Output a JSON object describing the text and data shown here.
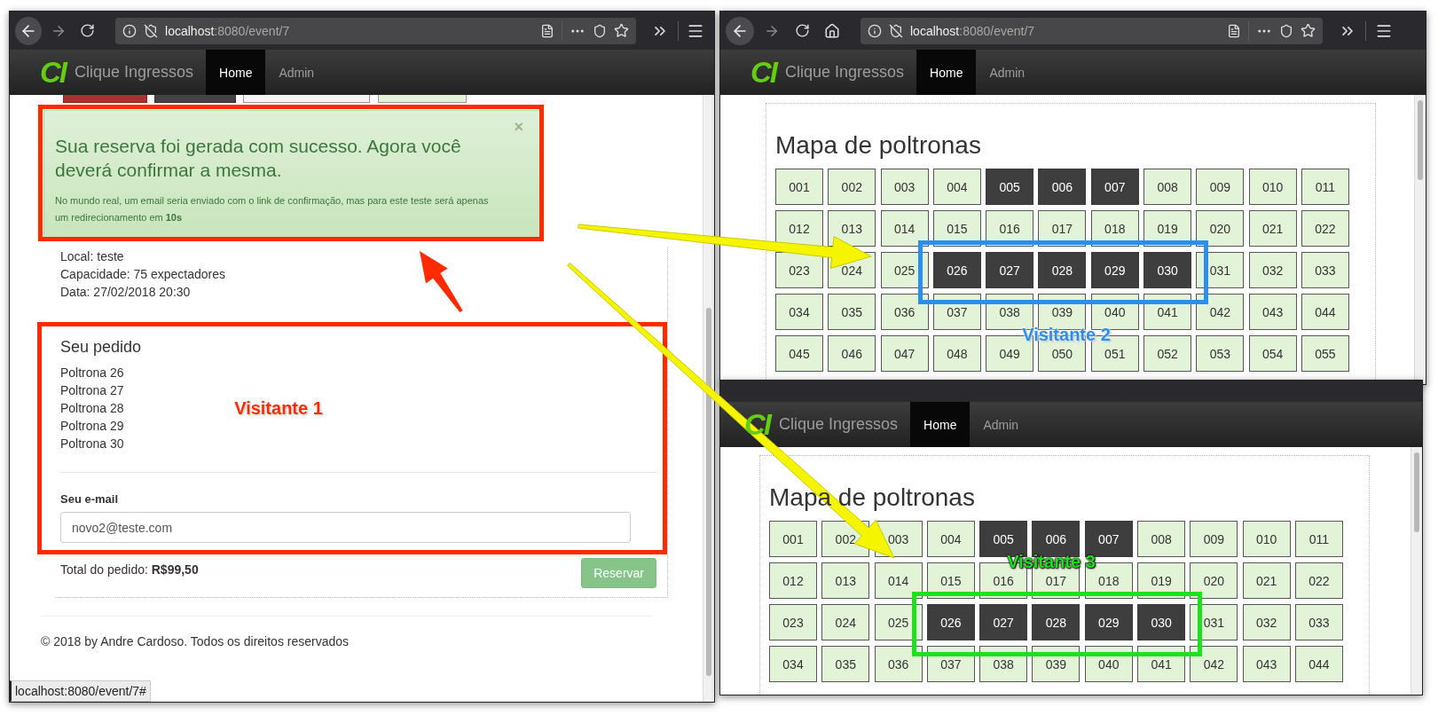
{
  "windows": [
    {
      "kind": "reservation",
      "toolbar": {
        "url_host": "localhost",
        "url_path": ":8080/event/7",
        "home_button": false
      },
      "navbar": {
        "logo": "CI",
        "brand": "Clique Ingressos",
        "tabs": [
          {
            "label": "Home",
            "selected": true
          },
          {
            "label": "Admin",
            "selected": false
          }
        ]
      },
      "page": {
        "alert": {
          "close": "×",
          "heading": "Sua reserva foi gerada com sucesso. Agora você deverá confirmar a mesma.",
          "body": "No mundo real, um email seria enviado com o link de confirmação, mas para este teste será apenas um redirecionamento em **10s**"
        },
        "event_info": [
          "Local: teste",
          "Capacidade: 75 expectadores",
          "Data: 27/02/2018 20:30"
        ],
        "order_heading": "Seu pedido",
        "order_items": [
          "Poltrona 26",
          "Poltrona 27",
          "Poltrona 28",
          "Poltrona 29",
          "Poltrona 30"
        ],
        "email_label": "Seu e-mail",
        "email_value": "novo2@teste.com",
        "total": "Total do pedido: **R$99,50**",
        "reserve_button": "Reservar",
        "footer": "© 2018 by Andre Cardoso. Todos os direitos reservados",
        "status_bar": "localhost:8080/event/7#"
      }
    },
    {
      "kind": "seat_map",
      "toolbar": {
        "url_host": "localhost",
        "url_path": ":8080/event/7",
        "home_button": true
      },
      "navbar": {
        "logo": "CI",
        "brand": "Clique Ingressos",
        "tabs": [
          {
            "label": "Home",
            "selected": true
          },
          {
            "label": "Admin",
            "selected": false
          }
        ]
      },
      "page": {
        "heading": "Mapa de poltronas",
        "seat_rows": [
          [
            {
              "label": "001",
              "taken": false
            },
            {
              "label": "002",
              "taken": false
            },
            {
              "label": "003",
              "taken": false
            },
            {
              "label": "004",
              "taken": false
            },
            {
              "label": "005",
              "taken": true
            },
            {
              "label": "006",
              "taken": true
            },
            {
              "label": "007",
              "taken": true
            },
            {
              "label": "008",
              "taken": false
            },
            {
              "label": "009",
              "taken": false
            },
            {
              "label": "010",
              "taken": false
            },
            {
              "label": "011",
              "taken": false
            }
          ],
          [
            {
              "label": "012",
              "taken": false
            },
            {
              "label": "013",
              "taken": false
            },
            {
              "label": "014",
              "taken": false
            },
            {
              "label": "015",
              "taken": false
            },
            {
              "label": "016",
              "taken": false
            },
            {
              "label": "017",
              "taken": false
            },
            {
              "label": "018",
              "taken": false
            },
            {
              "label": "019",
              "taken": false
            },
            {
              "label": "020",
              "taken": false
            },
            {
              "label": "021",
              "taken": false
            },
            {
              "label": "022",
              "taken": false
            }
          ],
          [
            {
              "label": "023",
              "taken": false
            },
            {
              "label": "024",
              "taken": false
            },
            {
              "label": "025",
              "taken": false
            },
            {
              "label": "026",
              "taken": true
            },
            {
              "label": "027",
              "taken": true
            },
            {
              "label": "028",
              "taken": true
            },
            {
              "label": "029",
              "taken": true
            },
            {
              "label": "030",
              "taken": true
            },
            {
              "label": "031",
              "taken": false
            },
            {
              "label": "032",
              "taken": false
            },
            {
              "label": "033",
              "taken": false
            }
          ],
          [
            {
              "label": "034",
              "taken": false
            },
            {
              "label": "035",
              "taken": false
            },
            {
              "label": "036",
              "taken": false
            },
            {
              "label": "037",
              "taken": false
            },
            {
              "label": "038",
              "taken": false
            },
            {
              "label": "039",
              "taken": false
            },
            {
              "label": "040",
              "taken": false
            },
            {
              "label": "041",
              "taken": false
            },
            {
              "label": "042",
              "taken": false
            },
            {
              "label": "043",
              "taken": false
            },
            {
              "label": "044",
              "taken": false
            }
          ],
          [
            {
              "label": "045",
              "taken": false
            },
            {
              "label": "046",
              "taken": false
            },
            {
              "label": "047",
              "taken": false
            },
            {
              "label": "048",
              "taken": false
            },
            {
              "label": "049",
              "taken": false
            },
            {
              "label": "050",
              "taken": false
            },
            {
              "label": "051",
              "taken": false
            },
            {
              "label": "052",
              "taken": false
            },
            {
              "label": "053",
              "taken": false
            },
            {
              "label": "054",
              "taken": false
            },
            {
              "label": "055",
              "taken": false
            }
          ]
        ]
      }
    },
    {
      "kind": "seat_map",
      "navbar": {
        "logo": "CI",
        "brand": "Clique Ingressos",
        "tabs": [
          {
            "label": "Home",
            "selected": true
          },
          {
            "label": "Admin",
            "selected": false
          }
        ]
      },
      "page": {
        "heading": "Mapa de poltronas",
        "seat_rows": [
          [
            {
              "label": "001",
              "taken": false
            },
            {
              "label": "002",
              "taken": false
            },
            {
              "label": "003",
              "taken": false
            },
            {
              "label": "004",
              "taken": false
            },
            {
              "label": "005",
              "taken": true
            },
            {
              "label": "006",
              "taken": true
            },
            {
              "label": "007",
              "taken": true
            },
            {
              "label": "008",
              "taken": false
            },
            {
              "label": "009",
              "taken": false
            },
            {
              "label": "010",
              "taken": false
            },
            {
              "label": "011",
              "taken": false
            }
          ],
          [
            {
              "label": "012",
              "taken": false
            },
            {
              "label": "013",
              "taken": false
            },
            {
              "label": "014",
              "taken": false
            },
            {
              "label": "015",
              "taken": false
            },
            {
              "label": "016",
              "taken": false
            },
            {
              "label": "017",
              "taken": false
            },
            {
              "label": "018",
              "taken": false
            },
            {
              "label": "019",
              "taken": false
            },
            {
              "label": "020",
              "taken": false
            },
            {
              "label": "021",
              "taken": false
            },
            {
              "label": "022",
              "taken": false
            }
          ],
          [
            {
              "label": "023",
              "taken": false
            },
            {
              "label": "024",
              "taken": false
            },
            {
              "label": "025",
              "taken": false
            },
            {
              "label": "026",
              "taken": true
            },
            {
              "label": "027",
              "taken": true
            },
            {
              "label": "028",
              "taken": true
            },
            {
              "label": "029",
              "taken": true
            },
            {
              "label": "030",
              "taken": true
            },
            {
              "label": "031",
              "taken": false
            },
            {
              "label": "032",
              "taken": false
            },
            {
              "label": "033",
              "taken": false
            }
          ],
          [
            {
              "label": "034",
              "taken": false
            },
            {
              "label": "035",
              "taken": false
            },
            {
              "label": "036",
              "taken": false
            },
            {
              "label": "037",
              "taken": false
            },
            {
              "label": "038",
              "taken": false
            },
            {
              "label": "039",
              "taken": false
            },
            {
              "label": "040",
              "taken": false
            },
            {
              "label": "041",
              "taken": false
            },
            {
              "label": "042",
              "taken": false
            },
            {
              "label": "043",
              "taken": false
            },
            {
              "label": "044",
              "taken": false
            }
          ]
        ]
      }
    }
  ],
  "annotations": {
    "frames": [
      {
        "color": "#ff2a00"
      },
      {
        "color": "#ff2a00"
      },
      {
        "color": "#2b8ff0"
      },
      {
        "color": "#1ee01e"
      }
    ],
    "arrows": [
      {
        "color": "#ff2a00"
      },
      {
        "color": "#f5f500"
      },
      {
        "color": "#f5f500"
      }
    ],
    "labels": [
      {
        "text": "Visitante 1",
        "color": "#ff2a00"
      },
      {
        "text": "Visitante 2",
        "color": "#2b8ff0"
      },
      {
        "text": "Visitante 3",
        "color": "#1ee01e"
      }
    ]
  }
}
